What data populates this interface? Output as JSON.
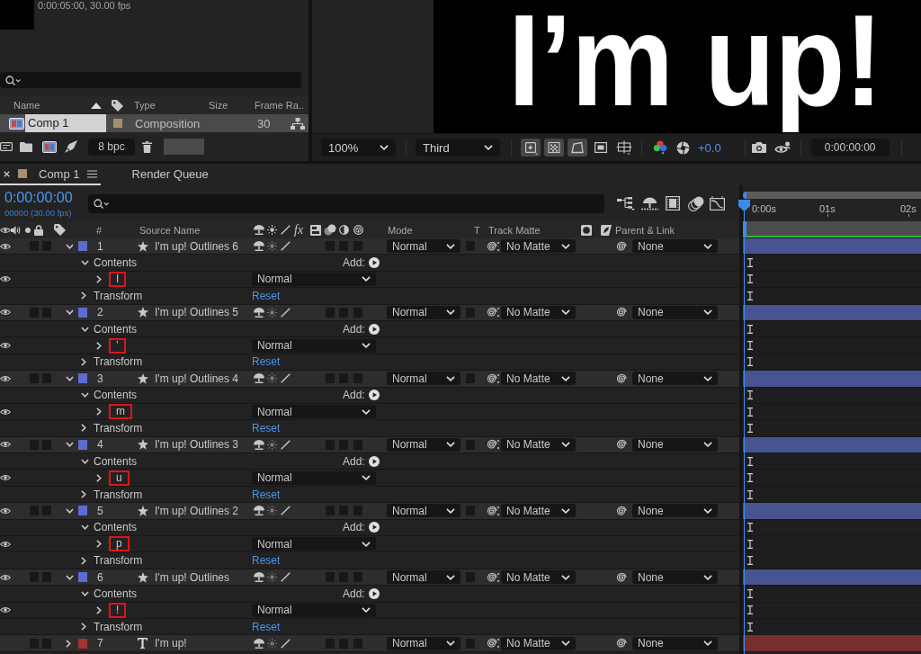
{
  "project_panel": {
    "comp_info": "0:00:05:00, 30.00 fps",
    "columns": [
      "Name",
      "Type",
      "Size",
      "Frame Ra.."
    ],
    "items": [
      {
        "name": "Comp 1",
        "type": "Composition",
        "frame_rate": "30",
        "color": "#a68f6e",
        "selected": true
      }
    ],
    "bit_depth": "8 bpc"
  },
  "viewer": {
    "canvas_text": "I’m up!",
    "zoom": "100%",
    "resolution": "Third",
    "toggles": [
      {
        "kind": "preview",
        "on": true
      },
      {
        "kind": "grid",
        "on": true
      },
      {
        "kind": "mask",
        "on": true
      },
      {
        "kind": "region",
        "on": false
      },
      {
        "kind": "guides",
        "on": false
      }
    ],
    "exposure": "+0.0",
    "time": "0:00:00:00"
  },
  "timeline": {
    "tabs": [
      {
        "label": "Comp 1",
        "selected": true,
        "closable": true,
        "color": "#a68f6e"
      },
      {
        "label": "Render Queue",
        "selected": false,
        "closable": false
      }
    ],
    "current_time": "0:00:00:00",
    "frame_info": "00000 (30.00 fps)",
    "ruler": [
      "0:00s",
      "01s",
      "02s"
    ],
    "columns": {
      "number": "#",
      "source_name": "Source Name",
      "effects": "fx",
      "mode": "Mode",
      "preserve": "T",
      "track_matte": "Track Matte",
      "parent": "Parent & Link"
    },
    "layers": [
      {
        "number": "1",
        "name": "I'm up! Outlines 6",
        "kind": "shape",
        "color": "#5b6cd1",
        "visible": true,
        "expanded": true,
        "mode": "Normal",
        "track_matte": "No Matte",
        "parent": "None",
        "properties": [
          {
            "kind": "contents",
            "label": "Contents",
            "expanded": true,
            "add": "Add:",
            "children": [
              {
                "kind": "group",
                "label": "I",
                "visible": true,
                "expanded": false,
                "highlighted": true,
                "blend": "Normal"
              }
            ]
          },
          {
            "kind": "transform",
            "label": "Transform",
            "expanded": false,
            "action": "Reset"
          }
        ]
      },
      {
        "number": "2",
        "name": "I'm up! Outlines 5",
        "kind": "shape",
        "color": "#5b6cd1",
        "visible": true,
        "expanded": true,
        "mode": "Normal",
        "track_matte": "No Matte",
        "parent": "None",
        "properties": [
          {
            "kind": "contents",
            "label": "Contents",
            "expanded": true,
            "add": "Add:",
            "children": [
              {
                "kind": "group",
                "label": "’",
                "visible": true,
                "expanded": false,
                "highlighted": true,
                "blend": "Normal"
              }
            ]
          },
          {
            "kind": "transform",
            "label": "Transform",
            "expanded": false,
            "action": "Reset"
          }
        ]
      },
      {
        "number": "3",
        "name": "I'm up! Outlines 4",
        "kind": "shape",
        "color": "#5b6cd1",
        "visible": true,
        "expanded": true,
        "mode": "Normal",
        "track_matte": "No Matte",
        "parent": "None",
        "properties": [
          {
            "kind": "contents",
            "label": "Contents",
            "expanded": true,
            "add": "Add:",
            "children": [
              {
                "kind": "group",
                "label": "m",
                "visible": true,
                "expanded": false,
                "highlighted": true,
                "blend": "Normal"
              }
            ]
          },
          {
            "kind": "transform",
            "label": "Transform",
            "expanded": false,
            "action": "Reset"
          }
        ]
      },
      {
        "number": "4",
        "name": "I'm up! Outlines 3",
        "kind": "shape",
        "color": "#5b6cd1",
        "visible": true,
        "expanded": true,
        "mode": "Normal",
        "track_matte": "No Matte",
        "parent": "None",
        "properties": [
          {
            "kind": "contents",
            "label": "Contents",
            "expanded": true,
            "add": "Add:",
            "children": [
              {
                "kind": "group",
                "label": "u",
                "visible": true,
                "expanded": false,
                "highlighted": true,
                "blend": "Normal"
              }
            ]
          },
          {
            "kind": "transform",
            "label": "Transform",
            "expanded": false,
            "action": "Reset"
          }
        ]
      },
      {
        "number": "5",
        "name": "I'm up! Outlines 2",
        "kind": "shape",
        "color": "#5b6cd1",
        "visible": true,
        "expanded": true,
        "mode": "Normal",
        "track_matte": "No Matte",
        "parent": "None",
        "properties": [
          {
            "kind": "contents",
            "label": "Contents",
            "expanded": true,
            "add": "Add:",
            "children": [
              {
                "kind": "group",
                "label": "p",
                "visible": true,
                "expanded": false,
                "highlighted": true,
                "blend": "Normal"
              }
            ]
          },
          {
            "kind": "transform",
            "label": "Transform",
            "expanded": false,
            "action": "Reset"
          }
        ]
      },
      {
        "number": "6",
        "name": "I'm up! Outlines",
        "kind": "shape",
        "color": "#5b6cd1",
        "visible": true,
        "expanded": true,
        "mode": "Normal",
        "track_matte": "No Matte",
        "parent": "None",
        "properties": [
          {
            "kind": "contents",
            "label": "Contents",
            "expanded": true,
            "add": "Add:",
            "children": [
              {
                "kind": "group",
                "label": "!",
                "visible": true,
                "expanded": false,
                "highlighted": true,
                "blend": "Normal"
              }
            ]
          },
          {
            "kind": "transform",
            "label": "Transform",
            "expanded": false,
            "action": "Reset"
          }
        ]
      },
      {
        "number": "7",
        "name": "I'm up!",
        "kind": "text",
        "color": "#a63131",
        "visible": false,
        "expanded": false,
        "mode": "Normal",
        "track_matte": "No Matte",
        "parent": "None"
      }
    ]
  }
}
